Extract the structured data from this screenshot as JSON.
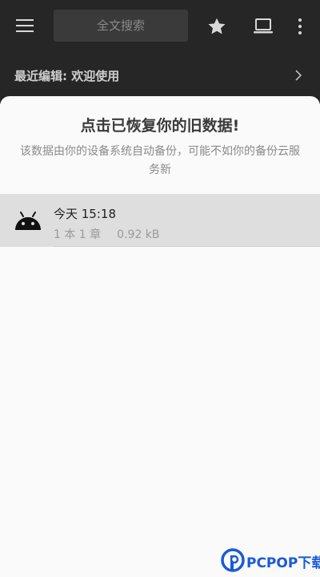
{
  "toolbar": {
    "search_placeholder": "全文搜索",
    "icons": [
      "menu-icon",
      "star-icon",
      "laptop-icon",
      "more-vert-icon"
    ]
  },
  "recent": {
    "label": "最近编辑: 欢迎使用",
    "icon": "chevron-right-icon"
  },
  "restore_sheet": {
    "title": "点击已恢复你的旧数据!",
    "description": "该数据由你的设备系统自动备份，可能不如你的备份云服务新",
    "items": [
      {
        "icon": "android-icon",
        "time": "今天 15:18",
        "counts": "1 本 1 章",
        "size": "0.92 kB"
      }
    ]
  },
  "watermark": {
    "text": "PCPOP下载"
  },
  "colors": {
    "top_bar": "#262626",
    "sheet_bg": "#fafafa",
    "item_bg": "#dedede",
    "watermark": "#1a5ad7"
  }
}
